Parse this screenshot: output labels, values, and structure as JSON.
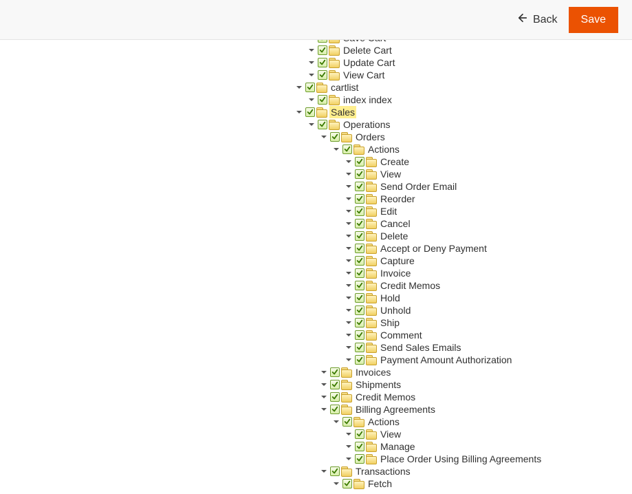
{
  "header": {
    "back_label": "Back",
    "save_label": "Save"
  },
  "tree": [
    {
      "label": "Save Cart",
      "indent": 3,
      "checked": true,
      "expanded": true,
      "hasChildren": false
    },
    {
      "label": "Delete Cart",
      "indent": 3,
      "checked": true,
      "expanded": true,
      "hasChildren": true
    },
    {
      "label": "Update Cart",
      "indent": 3,
      "checked": true,
      "expanded": true,
      "hasChildren": true
    },
    {
      "label": "View Cart",
      "indent": 3,
      "checked": true,
      "expanded": true,
      "hasChildren": true
    },
    {
      "label": "cartlist",
      "indent": 2,
      "checked": true,
      "expanded": true,
      "hasChildren": true
    },
    {
      "label": "index index",
      "indent": 3,
      "checked": true,
      "expanded": true,
      "hasChildren": true
    },
    {
      "label": "Sales",
      "indent": 2,
      "highlight": true,
      "checked": true,
      "expanded": true,
      "hasChildren": true
    },
    {
      "label": "Operations",
      "indent": 3,
      "checked": true,
      "expanded": true,
      "hasChildren": true
    },
    {
      "label": "Orders",
      "indent": 4,
      "checked": true,
      "expanded": true,
      "hasChildren": true
    },
    {
      "label": "Actions",
      "indent": 5,
      "checked": true,
      "expanded": true,
      "hasChildren": true
    },
    {
      "label": "Create",
      "indent": 6,
      "checked": true,
      "expanded": true,
      "hasChildren": true
    },
    {
      "label": "View",
      "indent": 6,
      "checked": true,
      "expanded": true,
      "hasChildren": true
    },
    {
      "label": "Send Order Email",
      "indent": 6,
      "checked": true,
      "expanded": true,
      "hasChildren": true
    },
    {
      "label": "Reorder",
      "indent": 6,
      "checked": true,
      "expanded": true,
      "hasChildren": true
    },
    {
      "label": "Edit",
      "indent": 6,
      "checked": true,
      "expanded": true,
      "hasChildren": true
    },
    {
      "label": "Cancel",
      "indent": 6,
      "checked": true,
      "expanded": true,
      "hasChildren": true
    },
    {
      "label": "Delete",
      "indent": 6,
      "checked": true,
      "expanded": true,
      "hasChildren": true
    },
    {
      "label": "Accept or Deny Payment",
      "indent": 6,
      "checked": true,
      "expanded": true,
      "hasChildren": true
    },
    {
      "label": "Capture",
      "indent": 6,
      "checked": true,
      "expanded": true,
      "hasChildren": true
    },
    {
      "label": "Invoice",
      "indent": 6,
      "checked": true,
      "expanded": true,
      "hasChildren": true
    },
    {
      "label": "Credit Memos",
      "indent": 6,
      "checked": true,
      "expanded": true,
      "hasChildren": true
    },
    {
      "label": "Hold",
      "indent": 6,
      "checked": true,
      "expanded": true,
      "hasChildren": true
    },
    {
      "label": "Unhold",
      "indent": 6,
      "checked": true,
      "expanded": true,
      "hasChildren": true
    },
    {
      "label": "Ship",
      "indent": 6,
      "checked": true,
      "expanded": true,
      "hasChildren": true
    },
    {
      "label": "Comment",
      "indent": 6,
      "checked": true,
      "expanded": true,
      "hasChildren": true
    },
    {
      "label": "Send Sales Emails",
      "indent": 6,
      "checked": true,
      "expanded": true,
      "hasChildren": true
    },
    {
      "label": "Payment Amount Authorization",
      "indent": 6,
      "checked": true,
      "expanded": true,
      "hasChildren": true
    },
    {
      "label": "Invoices",
      "indent": 4,
      "checked": true,
      "expanded": true,
      "hasChildren": true
    },
    {
      "label": "Shipments",
      "indent": 4,
      "checked": true,
      "expanded": true,
      "hasChildren": true
    },
    {
      "label": "Credit Memos",
      "indent": 4,
      "checked": true,
      "expanded": true,
      "hasChildren": true
    },
    {
      "label": "Billing Agreements",
      "indent": 4,
      "checked": true,
      "expanded": true,
      "hasChildren": true
    },
    {
      "label": "Actions",
      "indent": 5,
      "checked": true,
      "expanded": true,
      "hasChildren": true
    },
    {
      "label": "View",
      "indent": 6,
      "checked": true,
      "expanded": true,
      "hasChildren": true
    },
    {
      "label": "Manage",
      "indent": 6,
      "checked": true,
      "expanded": true,
      "hasChildren": true
    },
    {
      "label": "Place Order Using Billing Agreements",
      "indent": 6,
      "checked": true,
      "expanded": true,
      "hasChildren": true
    },
    {
      "label": "Transactions",
      "indent": 4,
      "checked": true,
      "expanded": true,
      "hasChildren": true
    },
    {
      "label": "Fetch",
      "indent": 5,
      "checked": true,
      "expanded": true,
      "hasChildren": true
    }
  ],
  "baseIndentPx": 394,
  "indentStepPx": 18
}
